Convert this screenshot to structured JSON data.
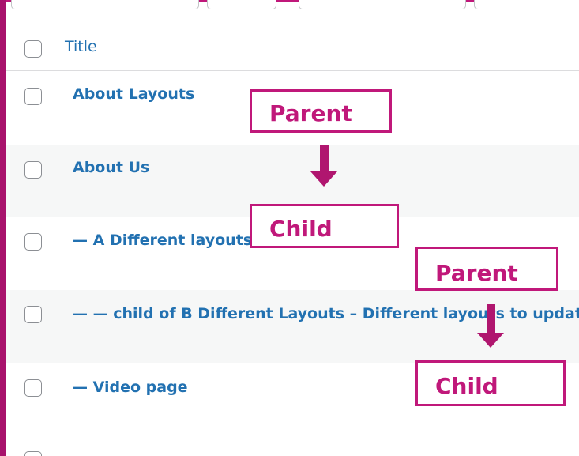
{
  "table": {
    "column_title": "Title",
    "rows": [
      {
        "title": "About Layouts"
      },
      {
        "title": "About Us"
      },
      {
        "title": "— A Different layouts"
      },
      {
        "title": "— — child of B Different Layouts – Different layouts to update"
      },
      {
        "title": "— Video page"
      }
    ]
  },
  "annotations": {
    "parent_1": "Parent",
    "child_1": "Child",
    "parent_2": "Parent",
    "child_2": "Child"
  },
  "colors": {
    "accent": "#c0187a",
    "link": "#2271b1",
    "row_alt": "#f6f7f7"
  }
}
